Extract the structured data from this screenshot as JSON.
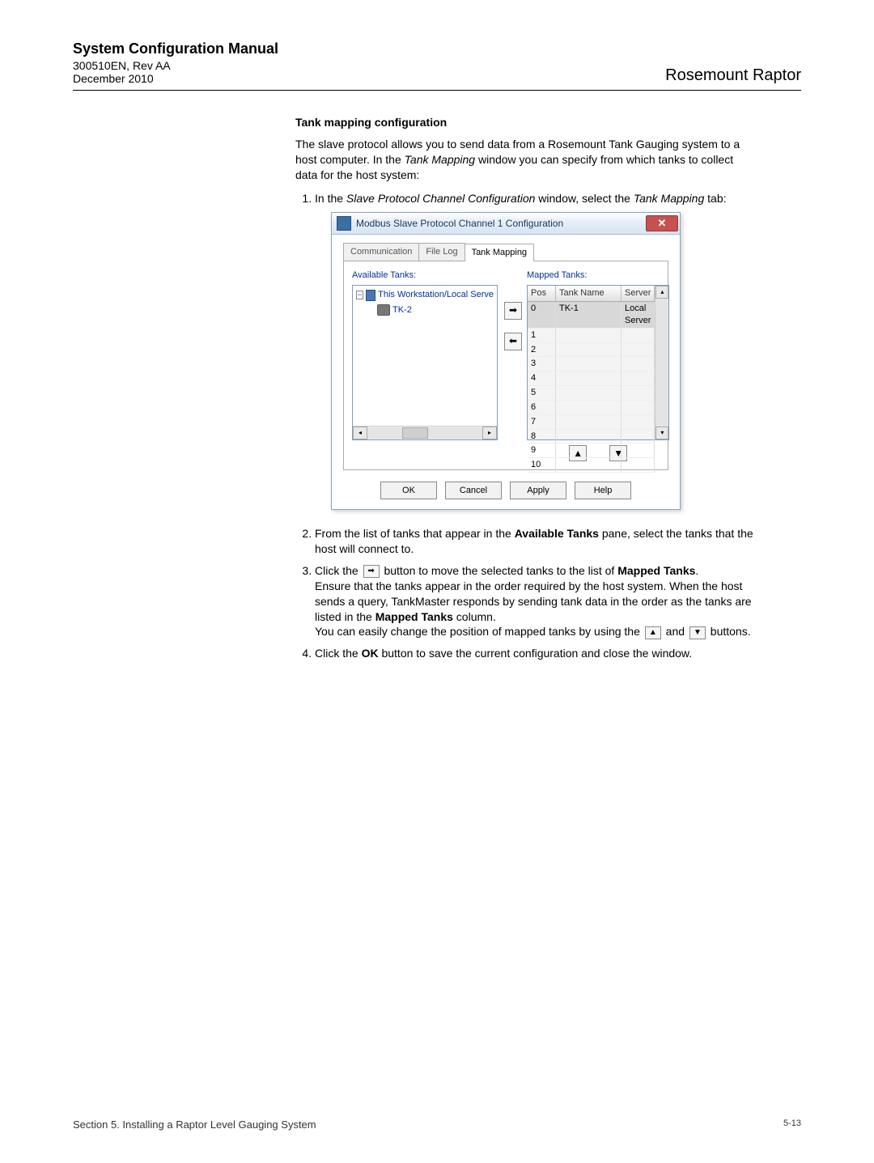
{
  "header": {
    "manual_title": "System Configuration Manual",
    "docnum": "300510EN, Rev AA",
    "date": "December 2010",
    "product": "Rosemount Raptor"
  },
  "section": {
    "title": "Tank mapping configuration",
    "intro_a": "The slave protocol allows you to send data from a Rosemount Tank Gauging system to a host computer. In the ",
    "intro_em": "Tank Mapping",
    "intro_b": " window you can specify from which tanks to collect data for the host system:",
    "step1_a": "In the ",
    "step1_em1": "Slave Protocol Channel Configuration",
    "step1_b": " window, select the ",
    "step1_em2": "Tank Mapping",
    "step1_c": " tab:",
    "step2_a": "From the list of tanks that appear in the ",
    "step2_b1": "Available Tanks",
    "step2_c": " pane, select the tanks that the host will connect to.",
    "step3_a": "Click the ",
    "step3_b": " button to move the selected tanks to the list of ",
    "step3_b1": "Mapped Tanks",
    "step3_c": ".",
    "step3_d": "Ensure that the tanks appear in the order required by the host system. When the host sends a query, TankMaster responds by sending tank data in the order as the tanks are listed in the ",
    "step3_d1": "Mapped Tanks",
    "step3_e": " column.",
    "step3_f": "You can easily change the position of mapped tanks by using the ",
    "step3_g": " and ",
    "step3_h": " buttons.",
    "step4_a": "Click the ",
    "step4_b": "OK",
    "step4_c": " button to save the current configuration and close the window."
  },
  "dialog": {
    "title": "Modbus Slave Protocol Channel 1 Configuration",
    "tabs": [
      "Communication",
      "File Log",
      "Tank Mapping"
    ],
    "active_tab": 2,
    "available_label": "Available Tanks:",
    "mapped_label": "Mapped Tanks:",
    "tree_root": "This Workstation/Local Serve",
    "tree_child": "TK-2",
    "list_headers": {
      "pos": "Pos",
      "tank": "Tank Name",
      "server": "Server"
    },
    "rows": [
      {
        "pos": "0",
        "tank": "TK-1",
        "server": "Local Server"
      },
      {
        "pos": "1",
        "tank": "",
        "server": ""
      },
      {
        "pos": "2",
        "tank": "",
        "server": ""
      },
      {
        "pos": "3",
        "tank": "",
        "server": ""
      },
      {
        "pos": "4",
        "tank": "",
        "server": ""
      },
      {
        "pos": "5",
        "tank": "",
        "server": ""
      },
      {
        "pos": "6",
        "tank": "",
        "server": ""
      },
      {
        "pos": "7",
        "tank": "",
        "server": ""
      },
      {
        "pos": "8",
        "tank": "",
        "server": ""
      },
      {
        "pos": "9",
        "tank": "",
        "server": ""
      },
      {
        "pos": "10",
        "tank": "",
        "server": ""
      }
    ],
    "buttons": {
      "ok": "OK",
      "cancel": "Cancel",
      "apply": "Apply",
      "help": "Help"
    }
  },
  "footer": {
    "section": "Section 5. Installing a Raptor Level Gauging System",
    "page": "5-13"
  },
  "icons": {
    "right_arrow": "➡",
    "left_arrow": "◀",
    "up_arrow": "▲",
    "down_arrow": "▼"
  }
}
